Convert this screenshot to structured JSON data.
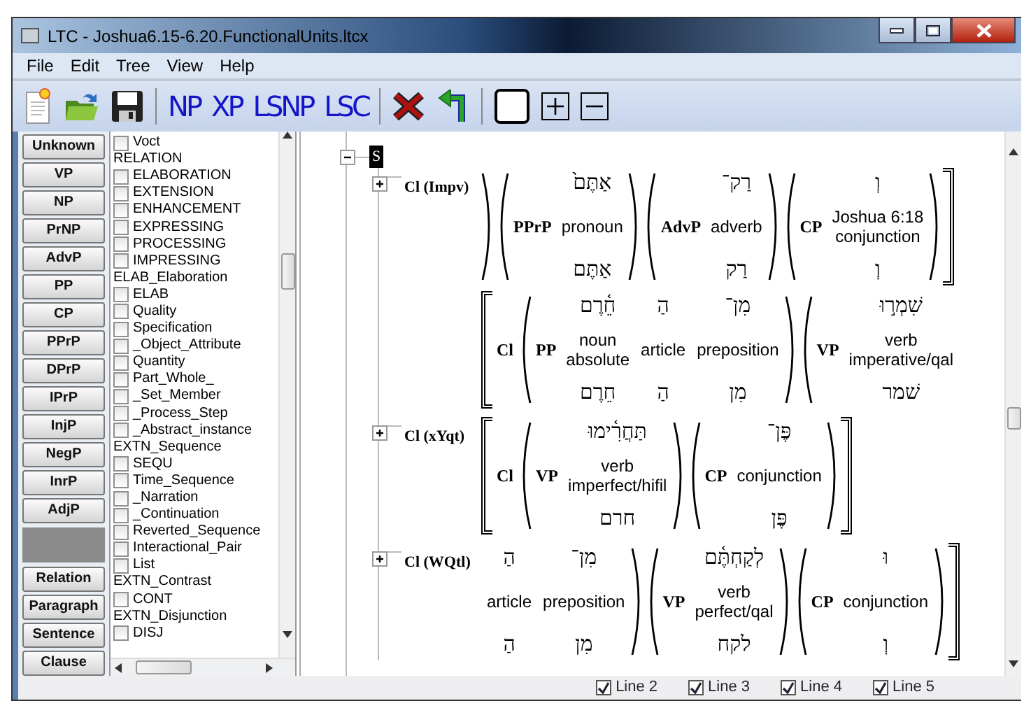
{
  "window": {
    "title": "LTC - Joshua6.15-6.20.FunctionalUnits.ltcx"
  },
  "menu": [
    "File",
    "Edit",
    "Tree",
    "View",
    "Help"
  ],
  "toolbar": [
    {
      "kind": "new"
    },
    {
      "kind": "open"
    },
    {
      "kind": "save"
    },
    {
      "kind": "sep"
    },
    {
      "kind": "text",
      "label": "NP"
    },
    {
      "kind": "text",
      "label": "XP"
    },
    {
      "kind": "text",
      "label": "LSNP"
    },
    {
      "kind": "text",
      "label": "LSC"
    },
    {
      "kind": "sep"
    },
    {
      "kind": "delete"
    },
    {
      "kind": "undo"
    },
    {
      "kind": "sep"
    },
    {
      "kind": "blank"
    },
    {
      "kind": "plus"
    },
    {
      "kind": "minus"
    }
  ],
  "phrase_buttons": [
    "Unknown",
    "VP",
    "NP",
    "PrNP",
    "AdvP",
    "PP",
    "CP",
    "PPrP",
    "DPrP",
    "IPrP",
    "InjP",
    "NegP",
    "InrP",
    "AdjP"
  ],
  "unit_buttons": [
    "Relation",
    "Paragraph",
    "Sentence",
    "Clause"
  ],
  "relations": [
    {
      "kind": "check",
      "label": "Voct",
      "checked": false
    },
    {
      "kind": "header",
      "label": "RELATION"
    },
    {
      "kind": "check",
      "label": "ELABORATION",
      "checked": false
    },
    {
      "kind": "check",
      "label": "EXTENSION",
      "checked": false
    },
    {
      "kind": "check",
      "label": "ENHANCEMENT",
      "checked": false
    },
    {
      "kind": "check",
      "label": "EXPRESSING",
      "checked": false
    },
    {
      "kind": "check",
      "label": "PROCESSING",
      "checked": false
    },
    {
      "kind": "check",
      "label": "IMPRESSING",
      "checked": false
    },
    {
      "kind": "header",
      "label": "ELAB_Elaboration"
    },
    {
      "kind": "check",
      "label": "ELAB",
      "checked": false
    },
    {
      "kind": "check",
      "label": "Quality",
      "checked": false
    },
    {
      "kind": "check",
      "label": "Specification",
      "checked": false
    },
    {
      "kind": "check",
      "label": "_Object_Attribute",
      "checked": false
    },
    {
      "kind": "check",
      "label": "Quantity",
      "checked": false
    },
    {
      "kind": "check",
      "label": "Part_Whole_",
      "checked": false
    },
    {
      "kind": "check",
      "label": "_Set_Member",
      "checked": false
    },
    {
      "kind": "check",
      "label": "_Process_Step",
      "checked": false
    },
    {
      "kind": "check",
      "label": "_Abstract_instance",
      "checked": false
    },
    {
      "kind": "header",
      "label": "EXTN_Sequence"
    },
    {
      "kind": "check",
      "label": "SEQU",
      "checked": false
    },
    {
      "kind": "check",
      "label": "Time_Sequence",
      "checked": false
    },
    {
      "kind": "check",
      "label": "_Narration",
      "checked": false
    },
    {
      "kind": "check",
      "label": "_Continuation",
      "checked": false
    },
    {
      "kind": "check",
      "label": "Reverted_Sequence",
      "checked": false
    },
    {
      "kind": "check",
      "label": "Interactional_Pair",
      "checked": false
    },
    {
      "kind": "check",
      "label": "List",
      "checked": false
    },
    {
      "kind": "header",
      "label": "EXTN_Contrast"
    },
    {
      "kind": "check",
      "label": "CONT",
      "checked": false
    },
    {
      "kind": "header",
      "label": "EXTN_Disjunction"
    },
    {
      "kind": "check",
      "label": "DISJ",
      "checked": false
    }
  ],
  "tree": {
    "root": {
      "label": "S",
      "selected": true,
      "expanded": true
    },
    "clauses": [
      {
        "label": "Cl (Impv)",
        "expanded": false,
        "rows": [
          {
            "bracket_open": false,
            "bracket_close": true,
            "phrases": [
              {
                "open": false,
                "close": true
              },
              {
                "open": true,
                "close": true,
                "label": "PPrP",
                "hebrew": [
                  "אַתֶּם֙"
                ],
                "glosses": [
                  {
                    "lines": [
                      "pronoun"
                    ]
                  }
                ],
                "lemmas": [
                  "אַתֶּם"
                ]
              },
              {
                "open": true,
                "close": true,
                "label": "AdvP",
                "hebrew": [
                  "רַק־"
                ],
                "glosses": [
                  {
                    "lines": [
                      "adverb"
                    ]
                  }
                ],
                "lemmas": [
                  "רַק"
                ]
              },
              {
                "open": true,
                "close": true,
                "label": "CP",
                "hebrew": [
                  "וְ"
                ],
                "glosses": [
                  {
                    "reference": "Joshua 6:18",
                    "lines": [
                      "conjunction"
                    ]
                  }
                ],
                "lemmas": [
                  "וְ"
                ]
              }
            ]
          },
          {
            "bracket_open": true,
            "bracket_close": false,
            "label": "Cl",
            "phrases": [
              {
                "open": true,
                "close": true,
                "label": "PP",
                "hebrew": [
                  "מִן־",
                  "הַ",
                  "חֵ֫רֶם"
                ],
                "glosses": [
                  {
                    "lines": [
                      "noun",
                      "absolute"
                    ]
                  },
                  {
                    "lines": [
                      "article"
                    ]
                  },
                  {
                    "lines": [
                      "preposition"
                    ]
                  }
                ],
                "lemmas": [
                  "מִן",
                  "הַ",
                  "חֵרֶם"
                ]
              },
              {
                "open": true,
                "close": false,
                "label": "VP",
                "hebrew": [
                  "שִׁמְר֣וּ"
                ],
                "glosses": [
                  {
                    "lines": [
                      "verb",
                      "imperative/qal"
                    ]
                  }
                ],
                "lemmas": [
                  "שׁמר"
                ]
              }
            ]
          }
        ]
      },
      {
        "label": "Cl (xYqt)",
        "expanded": false,
        "rows": [
          {
            "bracket_open": true,
            "bracket_close": true,
            "label": "Cl",
            "phrases": [
              {
                "open": true,
                "close": true,
                "label": "VP",
                "hebrew": [
                  "תַּחֲרִ֫ימוּ"
                ],
                "glosses": [
                  {
                    "lines": [
                      "verb",
                      "imperfect/hifil"
                    ]
                  }
                ],
                "lemmas": [
                  "חרם"
                ]
              },
              {
                "open": true,
                "close": true,
                "label": "CP",
                "hebrew": [
                  "פֶּן־"
                ],
                "glosses": [
                  {
                    "lines": [
                      "conjunction"
                    ]
                  }
                ],
                "lemmas": [
                  "פֶּן"
                ]
              }
            ]
          }
        ]
      },
      {
        "label": "Cl (WQtl)",
        "expanded": false,
        "rows": [
          {
            "bracket_open": false,
            "bracket_close": true,
            "phrases": [
              {
                "open": false,
                "close": true,
                "hebrew": [
                  "מִן־",
                  "הַ"
                ],
                "glosses": [
                  {
                    "lines": [
                      "article"
                    ]
                  },
                  {
                    "lines": [
                      "preposition"
                    ]
                  }
                ],
                "lemmas": [
                  "מִן",
                  "הַ"
                ]
              },
              {
                "open": true,
                "close": true,
                "label": "VP",
                "hebrew": [
                  "לְקַחְתֶּ֫ם"
                ],
                "glosses": [
                  {
                    "lines": [
                      "verb",
                      "perfect/qal"
                    ]
                  }
                ],
                "lemmas": [
                  "לקח"
                ]
              },
              {
                "open": true,
                "close": true,
                "label": "CP",
                "hebrew": [
                  "וּ"
                ],
                "glosses": [
                  {
                    "lines": [
                      "conjunction"
                    ]
                  }
                ],
                "lemmas": [
                  "וְ"
                ]
              }
            ]
          }
        ]
      }
    ]
  },
  "status_bar": [
    {
      "label": "Line 2",
      "checked": true
    },
    {
      "label": "Line 3",
      "checked": true
    },
    {
      "label": "Line 4",
      "checked": true
    },
    {
      "label": "Line 5",
      "checked": true
    }
  ]
}
